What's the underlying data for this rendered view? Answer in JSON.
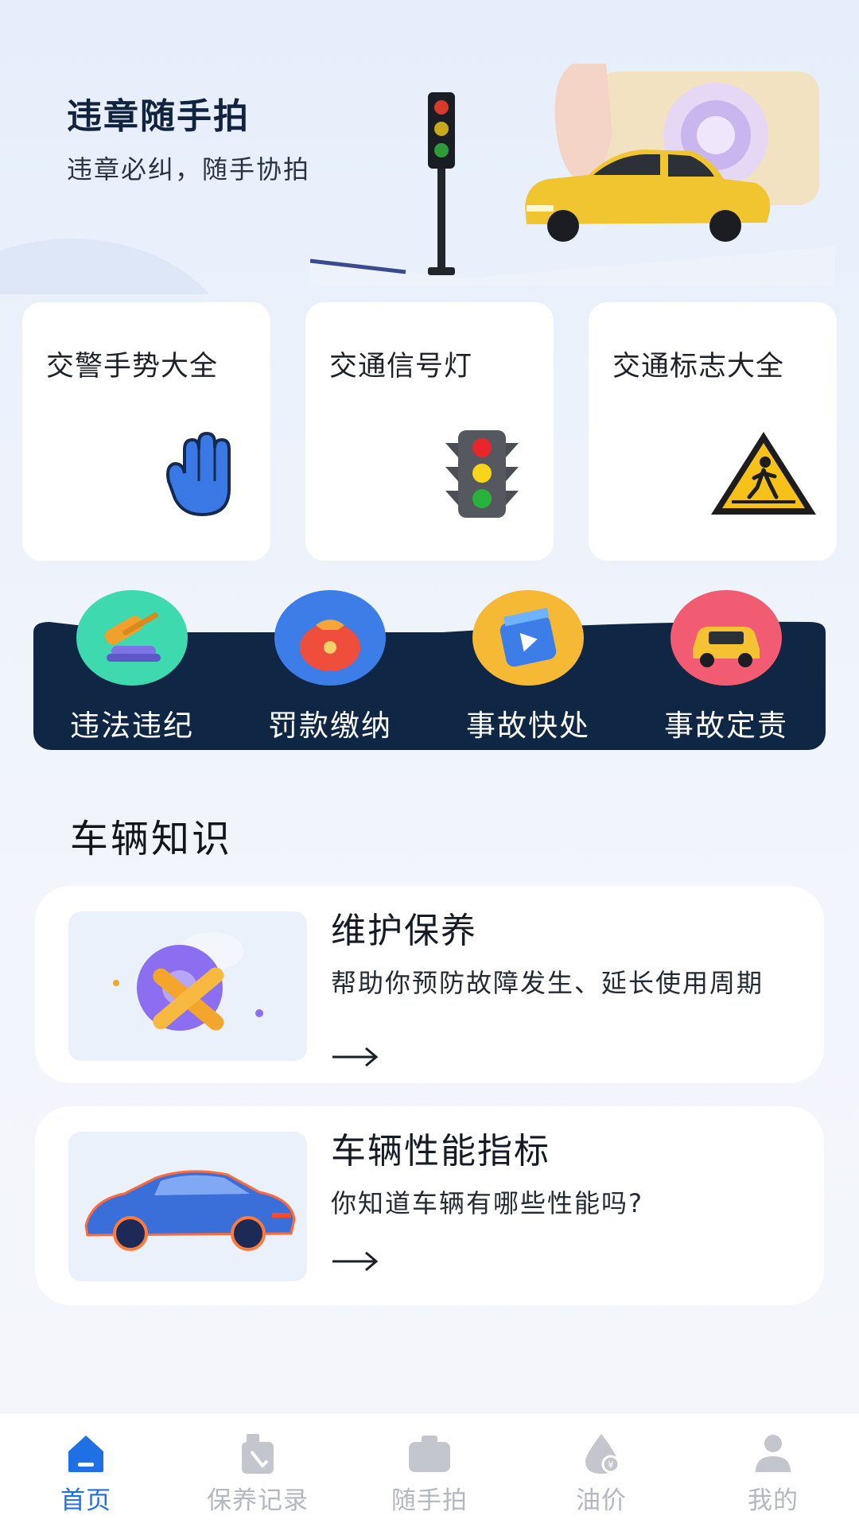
{
  "hero": {
    "title": "违章随手拍",
    "subtitle": "违章必纠，随手协拍"
  },
  "cards": [
    {
      "title": "交警手势大全",
      "icon": "hand-icon"
    },
    {
      "title": "交通信号灯",
      "icon": "traffic-light-icon"
    },
    {
      "title": "交通标志大全",
      "icon": "pedestrian-sign-icon"
    }
  ],
  "services": [
    {
      "label": "违法违纪",
      "icon": "gavel-icon",
      "color": "#3fd9b0"
    },
    {
      "label": "罚款缴纳",
      "icon": "money-bag-icon",
      "color": "#3d7de8"
    },
    {
      "label": "事故快处",
      "icon": "video-icon",
      "color": "#f5b935"
    },
    {
      "label": "事故定责",
      "icon": "car-icon",
      "color": "#f25c73"
    }
  ],
  "section": {
    "title": "车辆知识"
  },
  "knowledge": [
    {
      "title": "维护保养",
      "desc": "帮助你预防故障发生、延长使用周期",
      "icon": "wrench-gear-icon"
    },
    {
      "title": "车辆性能指标",
      "desc": "你知道车辆有哪些性能吗?",
      "icon": "sports-car-icon"
    }
  ],
  "tabs": [
    {
      "label": "首页",
      "icon": "home-icon",
      "active": true
    },
    {
      "label": "保养记录",
      "icon": "oil-can-icon",
      "active": false
    },
    {
      "label": "随手拍",
      "icon": "camera-icon",
      "active": false
    },
    {
      "label": "油价",
      "icon": "oil-drop-icon",
      "active": false
    },
    {
      "label": "我的",
      "icon": "user-icon",
      "active": false
    }
  ],
  "colors": {
    "accent": "#1f6fe5",
    "band": "#0f2645",
    "tab_inactive": "#b3b8c0"
  }
}
